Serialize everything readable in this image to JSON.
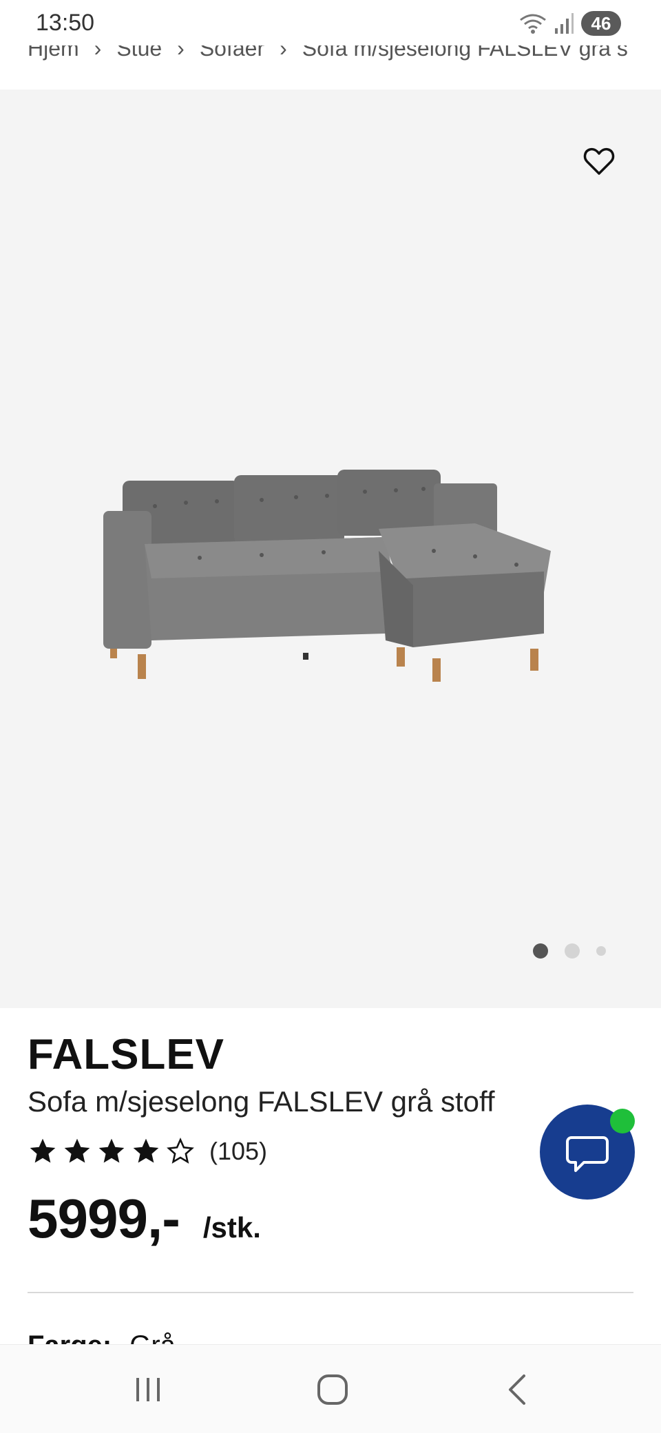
{
  "status_bar": {
    "time": "13:50",
    "battery": "46"
  },
  "breadcrumb": [
    "Hjem",
    "Stue",
    "Sofaer",
    "Sofa m/sjeselong FALSLEV grå s"
  ],
  "product": {
    "brand": "FALSLEV",
    "name": "Sofa m/sjeselong FALSLEV grå stoff",
    "rating": 4,
    "rating_max": 5,
    "review_count": "(105)",
    "price": "5999,-",
    "price_unit": "/stk.",
    "color_label": "Farge:",
    "color_value": "Grå"
  },
  "gallery": {
    "image_count": 3,
    "active_index": 0
  },
  "colors": {
    "chat_button": "#173d8f",
    "online_dot": "#1fbf3a",
    "image_bg": "#f4f4f4"
  },
  "icons": {
    "favorite": "heart-outline-icon",
    "chat": "chat-bubble-icon",
    "nav_recent": "recent-apps-icon",
    "nav_home": "home-icon",
    "nav_back": "back-icon"
  }
}
